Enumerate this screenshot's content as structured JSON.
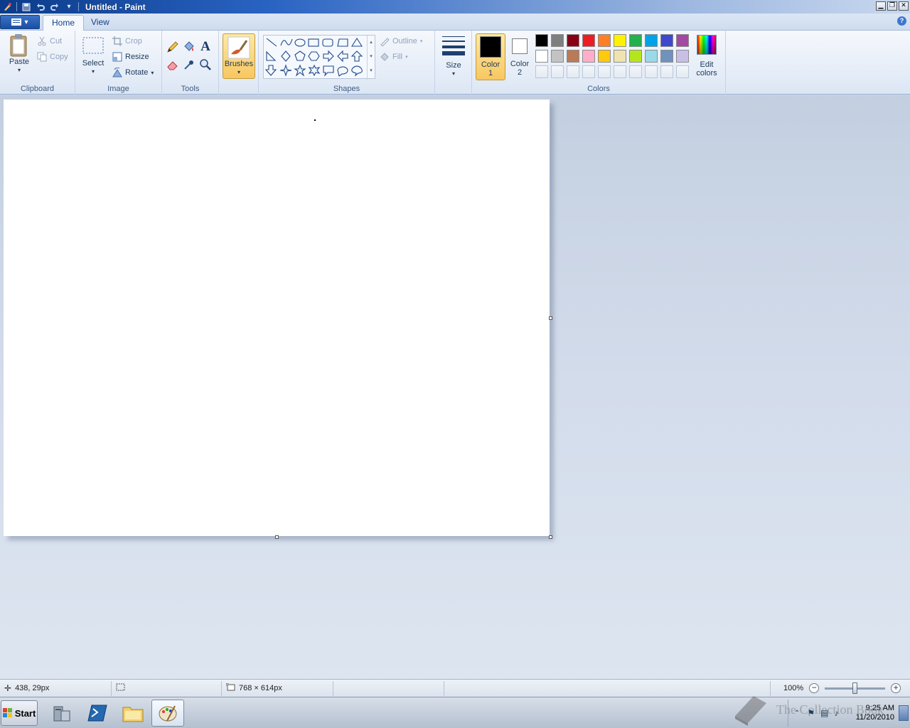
{
  "window": {
    "title": "Untitled - Paint"
  },
  "tabs": [
    {
      "label": "Home",
      "active": true
    },
    {
      "label": "View",
      "active": false
    }
  ],
  "clipboard": {
    "group_label": "Clipboard",
    "paste": "Paste",
    "cut": "Cut",
    "copy": "Copy"
  },
  "image": {
    "group_label": "Image",
    "select": "Select",
    "crop": "Crop",
    "resize": "Resize",
    "rotate": "Rotate"
  },
  "tools": {
    "group_label": "Tools"
  },
  "brushes": {
    "label": "Brushes"
  },
  "shapes": {
    "group_label": "Shapes",
    "outline": "Outline",
    "fill": "Fill"
  },
  "size": {
    "label": "Size"
  },
  "colors": {
    "group_label": "Colors",
    "color1_line1": "Color",
    "color1_line2": "1",
    "color2_line1": "Color",
    "color2_line2": "2",
    "edit_line1": "Edit",
    "edit_line2": "colors",
    "color1": "#000000",
    "color2": "#ffffff",
    "row1": [
      "#000000",
      "#7f7f7f",
      "#880015",
      "#ed1c24",
      "#ff7f27",
      "#fff200",
      "#22b14c",
      "#00a2e8",
      "#3f48cc",
      "#a349a4"
    ],
    "row2": [
      "#ffffff",
      "#c3c3c3",
      "#b97a57",
      "#ffaec9",
      "#ffc90e",
      "#efe4b0",
      "#b5e61d",
      "#99d9ea",
      "#7092be",
      "#c8bfe7"
    ]
  },
  "status": {
    "cursor_pos": "438, 29px",
    "image_size": "768 × 614px",
    "zoom": "100%",
    "zoom_level": 0.5
  },
  "taskbar": {
    "start": "Start",
    "time": "9:25 AM",
    "date": "11/20/2010"
  },
  "watermark": {
    "text": "The Collection Book"
  }
}
